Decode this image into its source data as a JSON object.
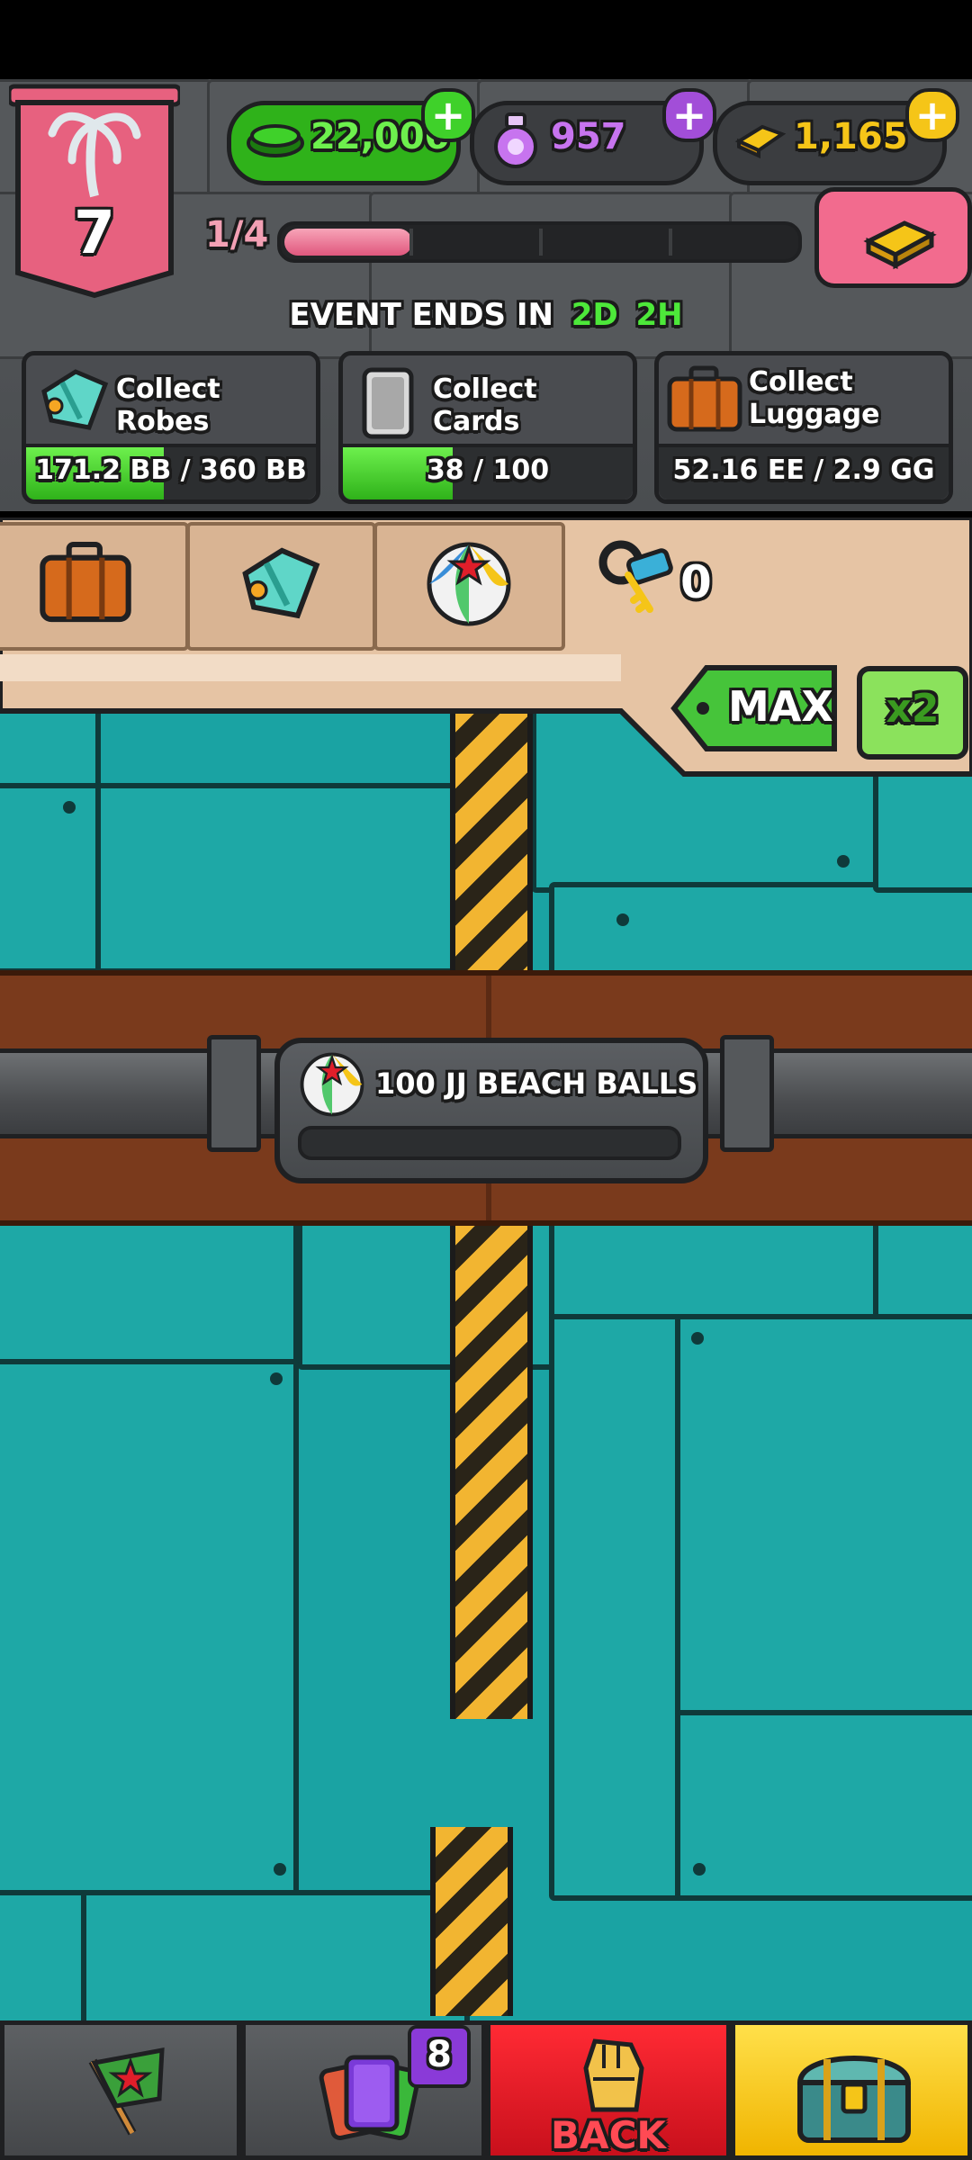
{
  "level": {
    "number": "7",
    "progress_text": "1/4",
    "progress_fraction": 0.25
  },
  "currencies": {
    "cash": {
      "value": "22,006",
      "icon": "cash-stack-icon"
    },
    "potion": {
      "value": "957",
      "icon": "potion-icon"
    },
    "gold": {
      "value": "1,165",
      "icon": "gold-bar-icon"
    }
  },
  "event": {
    "prefix": "EVENT ENDS IN",
    "days": "2D",
    "hours": "2H"
  },
  "tasks": [
    {
      "label": "Collect Robes",
      "progress": "171.2 BB / 360 BB",
      "fraction": 0.476,
      "icon": "robe-icon"
    },
    {
      "label": "Collect Cards",
      "progress": "38 / 100",
      "fraction": 0.38,
      "icon": "card-icon"
    },
    {
      "label_line1": "Collect",
      "label_line2": "Luggage",
      "progress": "52.16 EE / 2.9 GG",
      "fraction": 0.0,
      "icon": "luggage-icon"
    }
  ],
  "shelf": {
    "keys_count": "0",
    "max_label": "MAX",
    "multiplier_label": "x2"
  },
  "gate": {
    "label": "100 JJ BEACH BALLS",
    "fraction": 0.0
  },
  "nav": {
    "cards_badge": "8",
    "back_label": "BACK"
  },
  "colors": {
    "green": "#3fd12a",
    "pink": "#e0577d",
    "teal": "#1aa3a3",
    "red": "#e01e2a",
    "yellow": "#f5c518"
  }
}
